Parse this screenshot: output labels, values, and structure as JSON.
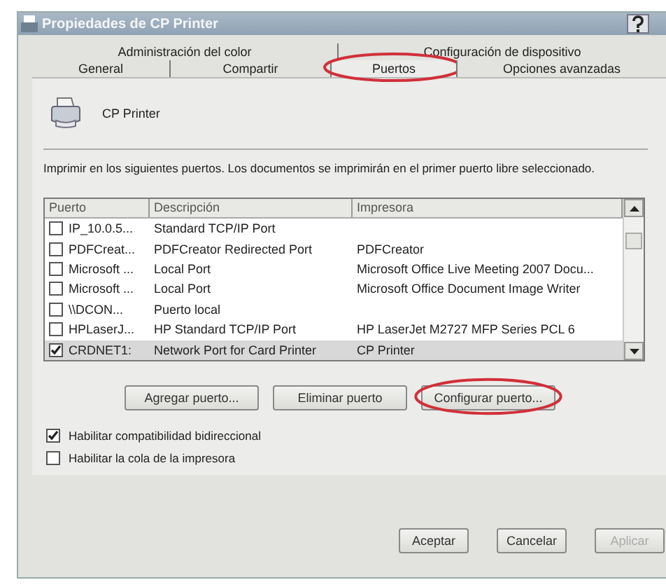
{
  "window": {
    "title": "Propiedades de CP Printer"
  },
  "tab_rows": [
    [
      {
        "label": "Administración del color",
        "selected": false,
        "circled": false
      },
      {
        "label": "Configuración de dispositivo",
        "selected": false,
        "circled": false
      }
    ],
    [
      {
        "label": "General",
        "selected": false,
        "circled": false
      },
      {
        "label": "Compartir",
        "selected": false,
        "circled": false
      },
      {
        "label": "Puertos",
        "selected": true,
        "circled": true
      },
      {
        "label": "Opciones avanzadas",
        "selected": false,
        "circled": false
      }
    ]
  ],
  "printer": {
    "name": "CP Printer"
  },
  "instructions": "Imprimir en los siguientes puertos. Los documentos se imprimirán en el primer puerto libre seleccionado.",
  "ports": {
    "columns": [
      "Puerto",
      "Descripción",
      "Impresora"
    ],
    "rows": [
      {
        "port": "IP_10.0.5...",
        "description": "Standard TCP/IP Port",
        "printer": "",
        "checked": false,
        "selected": false
      },
      {
        "port": "PDFCreat...",
        "description": "PDFCreator Redirected Port",
        "printer": "PDFCreator",
        "checked": false,
        "selected": false
      },
      {
        "port": "Microsoft ...",
        "description": "Local Port",
        "printer": "Microsoft Office Live Meeting 2007 Docu...",
        "checked": false,
        "selected": false
      },
      {
        "port": "Microsoft ...",
        "description": "Local Port",
        "printer": "Microsoft Office Document Image Writer",
        "checked": false,
        "selected": false
      },
      {
        "port": "\\\\DCON...",
        "description": "Puerto local",
        "printer": "",
        "checked": false,
        "selected": false
      },
      {
        "port": "HPLaserJ...",
        "description": "HP Standard TCP/IP Port",
        "printer": "HP LaserJet M2727 MFP Series PCL 6",
        "checked": false,
        "selected": false
      },
      {
        "port": "CRDNET1:",
        "description": "Network Port for Card Printer",
        "printer": "CP Printer",
        "checked": true,
        "selected": true
      }
    ]
  },
  "port_buttons": [
    {
      "label": "Agregar puerto...",
      "circled": false
    },
    {
      "label": "Eliminar puerto",
      "circled": false
    },
    {
      "label": "Configurar puerto...",
      "circled": true
    }
  ],
  "options": [
    {
      "label": "Habilitar compatibilidad bidireccional",
      "checked": true
    },
    {
      "label": "Habilitar la cola de la impresora",
      "checked": false
    }
  ],
  "dialog_buttons": [
    {
      "label": "Aceptar",
      "disabled": false
    },
    {
      "label": "Cancelar",
      "disabled": false
    },
    {
      "label": "Aplicar",
      "disabled": true
    }
  ]
}
